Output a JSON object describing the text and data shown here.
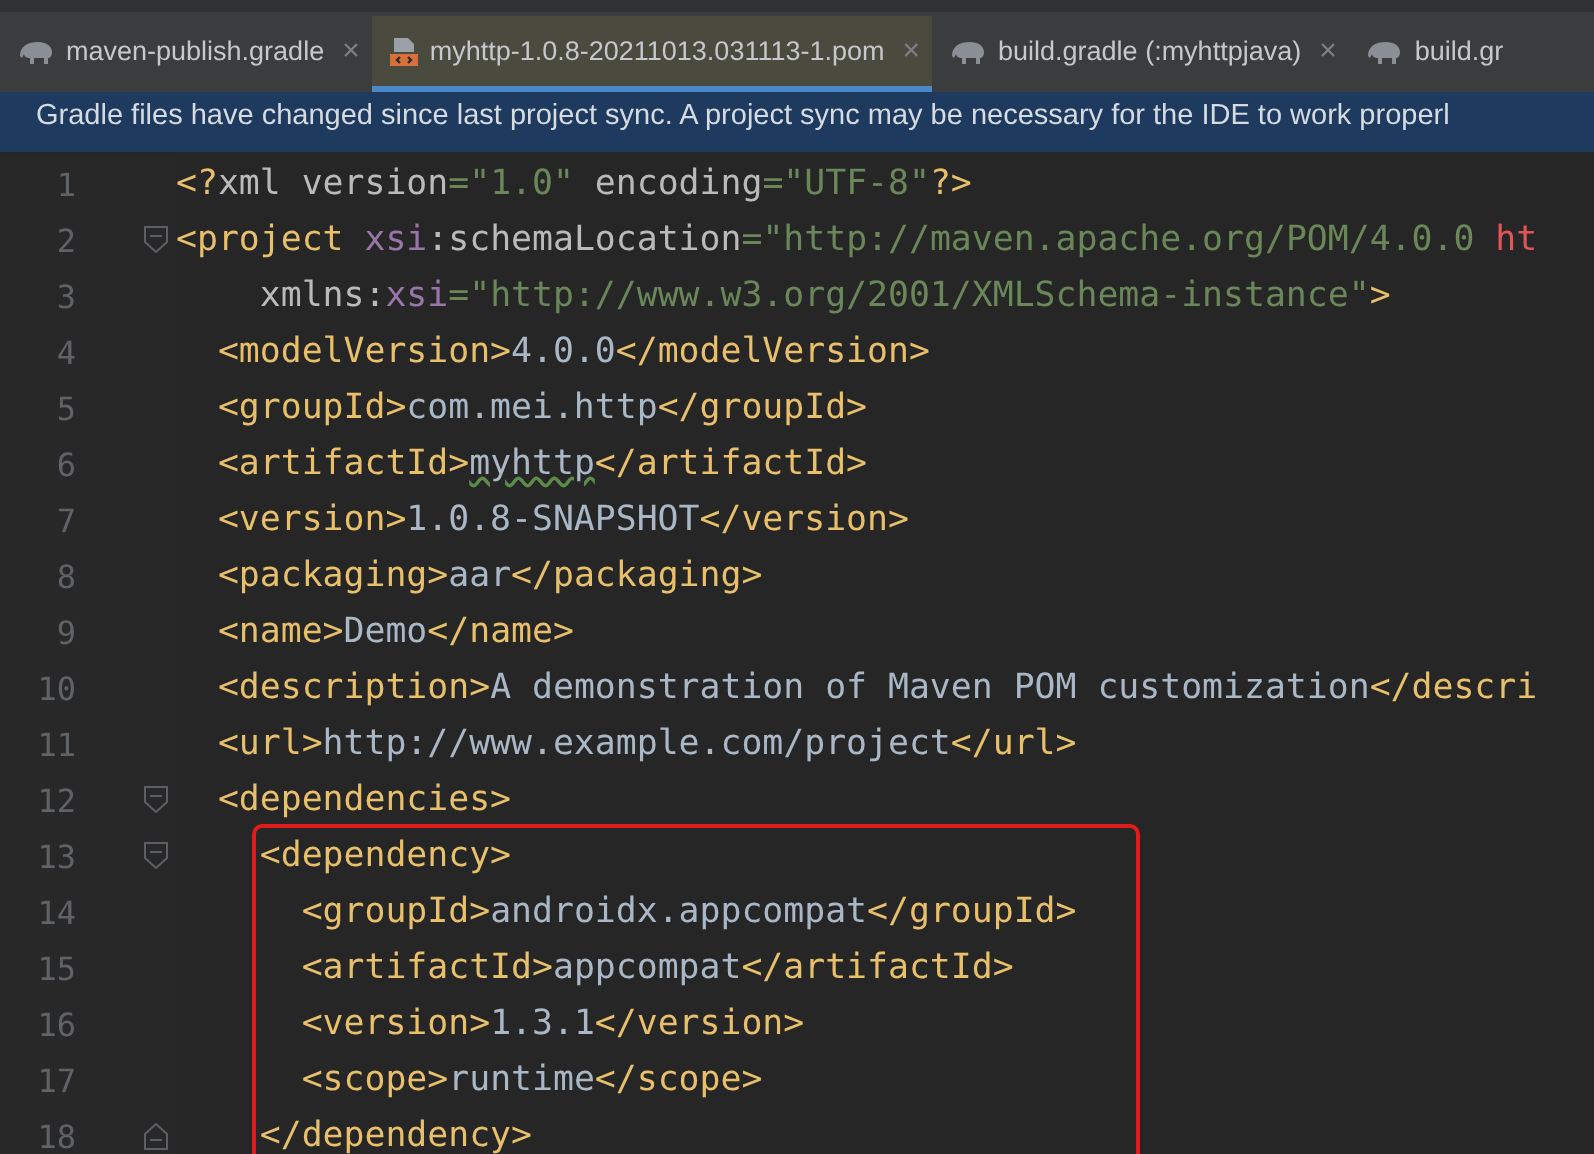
{
  "tabs": [
    {
      "label": "maven-publish.gradle",
      "kind": "gradle",
      "selected": false,
      "close": "×"
    },
    {
      "label": "myhttp-1.0.8-20211013.031113-1.pom",
      "kind": "pom",
      "selected": true,
      "close": "×"
    },
    {
      "label": "build.gradle (:myhttpjava)",
      "kind": "gradle",
      "selected": false,
      "close": "×"
    },
    {
      "label": "build.gr",
      "kind": "gradle",
      "selected": false
    }
  ],
  "banner": {
    "text": "Gradle files have changed since last project sync. A project sync may be necessary for the IDE to work properl"
  },
  "editor": {
    "lines": [
      {
        "number": "1",
        "kind": "plain",
        "highlighted": false,
        "tokens": [
          {
            "kind": "tag",
            "text": "<?"
          },
          {
            "kind": "attr",
            "text": "xml version"
          },
          {
            "kind": "value",
            "text": "=\"1.0\""
          },
          {
            "kind": "attr",
            "text": " encoding"
          },
          {
            "kind": "value",
            "text": "=\"UTF-8\""
          },
          {
            "kind": "tag",
            "text": "?>"
          }
        ]
      },
      {
        "number": "2",
        "kind": "opener",
        "highlighted": false,
        "tokens": [
          {
            "kind": "tag",
            "text": "<project "
          },
          {
            "kind": "ns",
            "text": "xsi"
          },
          {
            "kind": "attr",
            "text": ":schemaLocation"
          },
          {
            "kind": "value",
            "text": "=\"http://maven.apache.org/POM/4.0.0 "
          },
          {
            "kind": "error",
            "text": "ht"
          }
        ]
      },
      {
        "number": "3",
        "kind": "plain",
        "highlighted": false,
        "tokens": [
          {
            "kind": "attr",
            "text": "    xmlns:"
          },
          {
            "kind": "ns",
            "text": "xsi"
          },
          {
            "kind": "value",
            "text": "=\"http://www.w3.org/2001/XMLSchema-instance\""
          },
          {
            "kind": "tag",
            "text": ">"
          }
        ]
      },
      {
        "number": "4",
        "kind": "plain",
        "highlighted": false,
        "tokens": [
          {
            "kind": "tag",
            "text": "  <modelVersion>"
          },
          {
            "kind": "text",
            "text": "4.0.0"
          },
          {
            "kind": "tag",
            "text": "</modelVersion>"
          }
        ]
      },
      {
        "number": "5",
        "kind": "plain",
        "highlighted": false,
        "tokens": [
          {
            "kind": "tag",
            "text": "  <groupId>"
          },
          {
            "kind": "text",
            "text": "com.mei.http"
          },
          {
            "kind": "tag",
            "text": "</groupId>"
          }
        ]
      },
      {
        "number": "6",
        "kind": "plain",
        "highlighted": false,
        "tokens": [
          {
            "kind": "tag",
            "text": "  <artifactId>"
          },
          {
            "kind": "typo",
            "text": "myhttp"
          },
          {
            "kind": "tag",
            "text": "</artifactId>"
          }
        ]
      },
      {
        "number": "7",
        "kind": "plain",
        "highlighted": false,
        "tokens": [
          {
            "kind": "tag",
            "text": "  <version>"
          },
          {
            "kind": "text",
            "text": "1.0.8-SNAPSHOT"
          },
          {
            "kind": "tag",
            "text": "</version>"
          }
        ]
      },
      {
        "number": "8",
        "kind": "plain",
        "highlighted": false,
        "tokens": [
          {
            "kind": "tag",
            "text": "  <packaging>"
          },
          {
            "kind": "text",
            "text": "aar"
          },
          {
            "kind": "tag",
            "text": "</packaging>"
          }
        ]
      },
      {
        "number": "9",
        "kind": "plain",
        "highlighted": false,
        "tokens": [
          {
            "kind": "tag",
            "text": "  <name>"
          },
          {
            "kind": "text",
            "text": "Demo"
          },
          {
            "kind": "tag",
            "text": "</name>"
          }
        ]
      },
      {
        "number": "10",
        "kind": "plain",
        "highlighted": false,
        "tokens": [
          {
            "kind": "tag",
            "text": "  <description>"
          },
          {
            "kind": "text",
            "text": "A demonstration of Maven POM customization"
          },
          {
            "kind": "tag",
            "text": "</descri"
          }
        ]
      },
      {
        "number": "11",
        "kind": "plain",
        "highlighted": false,
        "tokens": [
          {
            "kind": "tag",
            "text": "  <url>"
          },
          {
            "kind": "text",
            "text": "http://www.example.com/project"
          },
          {
            "kind": "tag",
            "text": "</url>"
          }
        ]
      },
      {
        "number": "12",
        "kind": "opener",
        "highlighted": false,
        "tokens": [
          {
            "kind": "tag",
            "text": "  <dependencies>"
          }
        ]
      },
      {
        "number": "13",
        "kind": "opener",
        "highlighted": true,
        "tokens": [
          {
            "kind": "tag",
            "text": "    <dependency>"
          }
        ]
      },
      {
        "number": "14",
        "kind": "plain",
        "highlighted": true,
        "tokens": [
          {
            "kind": "tag",
            "text": "      <groupId>"
          },
          {
            "kind": "text",
            "text": "androidx.appcompat"
          },
          {
            "kind": "tag",
            "text": "</groupId>"
          }
        ]
      },
      {
        "number": "15",
        "kind": "plain",
        "highlighted": true,
        "tokens": [
          {
            "kind": "tag",
            "text": "      <artifactId>"
          },
          {
            "kind": "text",
            "text": "appcompat"
          },
          {
            "kind": "tag",
            "text": "</artifactId>"
          }
        ]
      },
      {
        "number": "16",
        "kind": "plain",
        "highlighted": true,
        "tokens": [
          {
            "kind": "tag",
            "text": "      <version>"
          },
          {
            "kind": "text",
            "text": "1.3.1"
          },
          {
            "kind": "tag",
            "text": "</version>"
          }
        ]
      },
      {
        "number": "17",
        "kind": "plain",
        "highlighted": true,
        "tokens": [
          {
            "kind": "tag",
            "text": "      <scope>"
          },
          {
            "kind": "text",
            "text": "runtime"
          },
          {
            "kind": "tag",
            "text": "</scope>"
          }
        ]
      },
      {
        "number": "18",
        "kind": "closer",
        "highlighted": true,
        "tokens": [
          {
            "kind": "tag",
            "text": "    </dependency>"
          }
        ]
      }
    ]
  }
}
